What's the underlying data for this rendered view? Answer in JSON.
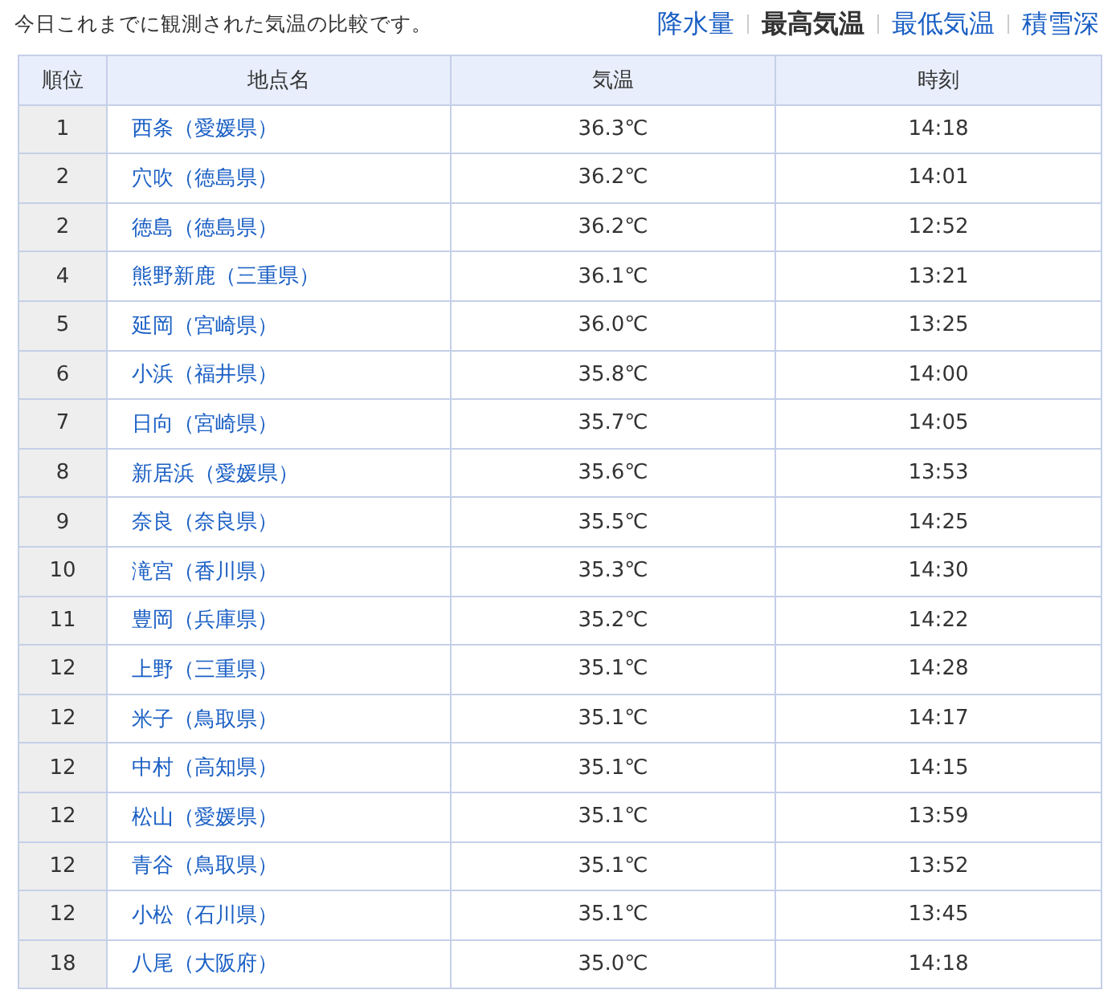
{
  "intro": "今日これまでに観測された気温の比較です。",
  "tabs": [
    {
      "label": "降水量",
      "selected": false
    },
    {
      "label": "最高気温",
      "selected": true
    },
    {
      "label": "最低気温",
      "selected": false
    },
    {
      "label": "積雪深",
      "selected": false
    }
  ],
  "table": {
    "columns": [
      "順位",
      "地点名",
      "気温",
      "時刻"
    ],
    "rows": [
      {
        "rank": "1",
        "place": "西条（愛媛県）",
        "temp": "36.3℃",
        "time": "14:18"
      },
      {
        "rank": "2",
        "place": "穴吹（徳島県）",
        "temp": "36.2℃",
        "time": "14:01"
      },
      {
        "rank": "2",
        "place": "徳島（徳島県）",
        "temp": "36.2℃",
        "time": "12:52"
      },
      {
        "rank": "4",
        "place": "熊野新鹿（三重県）",
        "temp": "36.1℃",
        "time": "13:21"
      },
      {
        "rank": "5",
        "place": "延岡（宮崎県）",
        "temp": "36.0℃",
        "time": "13:25"
      },
      {
        "rank": "6",
        "place": "小浜（福井県）",
        "temp": "35.8℃",
        "time": "14:00"
      },
      {
        "rank": "7",
        "place": "日向（宮崎県）",
        "temp": "35.7℃",
        "time": "14:05"
      },
      {
        "rank": "8",
        "place": "新居浜（愛媛県）",
        "temp": "35.6℃",
        "time": "13:53"
      },
      {
        "rank": "9",
        "place": "奈良（奈良県）",
        "temp": "35.5℃",
        "time": "14:25"
      },
      {
        "rank": "10",
        "place": "滝宮（香川県）",
        "temp": "35.3℃",
        "time": "14:30"
      },
      {
        "rank": "11",
        "place": "豊岡（兵庫県）",
        "temp": "35.2℃",
        "time": "14:22"
      },
      {
        "rank": "12",
        "place": "上野（三重県）",
        "temp": "35.1℃",
        "time": "14:28"
      },
      {
        "rank": "12",
        "place": "米子（鳥取県）",
        "temp": "35.1℃",
        "time": "14:17"
      },
      {
        "rank": "12",
        "place": "中村（高知県）",
        "temp": "35.1℃",
        "time": "14:15"
      },
      {
        "rank": "12",
        "place": "松山（愛媛県）",
        "temp": "35.1℃",
        "time": "13:59"
      },
      {
        "rank": "12",
        "place": "青谷（鳥取県）",
        "temp": "35.1℃",
        "time": "13:52"
      },
      {
        "rank": "12",
        "place": "小松（石川県）",
        "temp": "35.1℃",
        "time": "13:45"
      },
      {
        "rank": "18",
        "place": "八尾（大阪府）",
        "temp": "35.0℃",
        "time": "14:18"
      }
    ]
  }
}
